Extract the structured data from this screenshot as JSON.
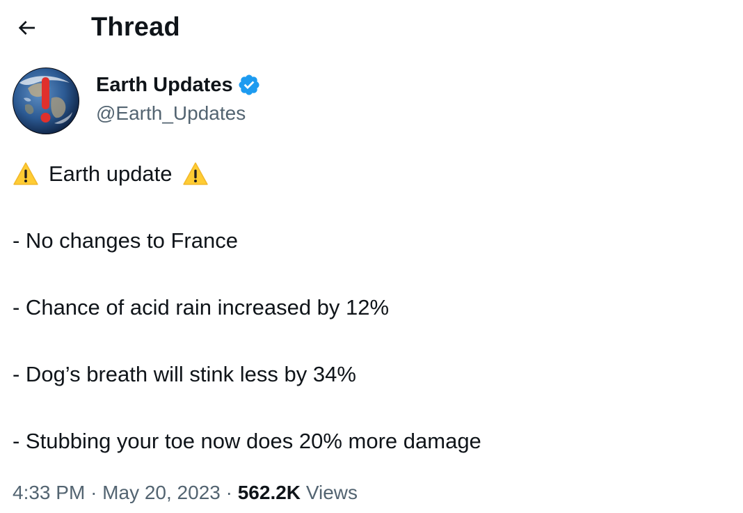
{
  "header": {
    "title": "Thread"
  },
  "author": {
    "display_name": "Earth Updates",
    "handle": "@Earth_Updates",
    "verified": true
  },
  "tweet": {
    "headline": "Earth update",
    "lines": [
      "- No changes to France",
      "- Chance of acid rain increased by 12%",
      "- Dog’s breath will stink less by 34%",
      "- Stubbing your toe now does 20% more damage"
    ]
  },
  "meta": {
    "time": "4:33 PM",
    "separator": "·",
    "date": "May 20, 2023",
    "views_count": "562.2K",
    "views_label": "Views"
  },
  "colors": {
    "text": "#0f1419",
    "secondary": "#536471",
    "verified_blue": "#1d9bf0",
    "warning_yellow": "#ffcc33"
  },
  "icons": {
    "back": "arrow-left-icon",
    "verified": "verified-badge-icon",
    "warning": "warning-sign-icon"
  }
}
